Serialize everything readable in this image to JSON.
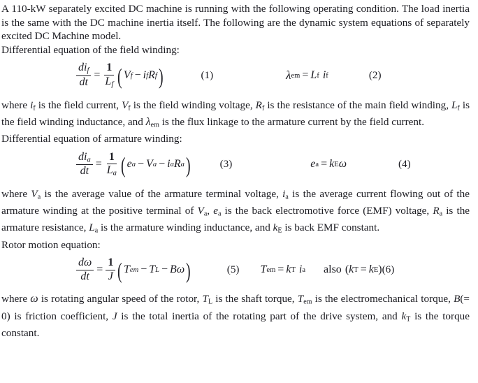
{
  "document": {
    "type": "engineering-problem-statement",
    "topic": "Separately excited DC machine dynamic model"
  },
  "intro": {
    "line1": "A 110-kW separately excited DC machine is running with the following operating condition. The",
    "line2": "load inertia is the same with the DC machine inertia itself. The following are the dynamic system",
    "line3": "equations of separately excited DC Machine model.",
    "field_heading": "Differential equation of the field winding:"
  },
  "equation1": {
    "lhs_num_d": "d",
    "lhs_num_i": "i",
    "lhs_num_sub": "f",
    "lhs_den_d": "d",
    "lhs_den_t": "t",
    "equals": "=",
    "rhs_num": "1",
    "rhs_den_L": "L",
    "rhs_den_sub": "f",
    "open_paren": "(",
    "V": "V",
    "V_sub": "f",
    "minus": "−",
    "i": "i",
    "i_sub": "f",
    "R": "R",
    "R_sub": "f",
    "close_paren": ")",
    "number": "(1)"
  },
  "equation2": {
    "lambda": "λ",
    "lambda_sub": "em",
    "equals": "=",
    "L": "L",
    "L_sub": "f",
    "i": "i",
    "i_sub": "f",
    "number": "(2)"
  },
  "para_field": {
    "line1_a": "where ",
    "i_f_i": "i",
    "i_f_sub": "f",
    "line1_b": " is the field current, ",
    "V_f_i": "V",
    "V_f_sub": "f",
    "line1_c": " is the field winding voltage, ",
    "R_f_i": "R",
    "R_f_sub": "f",
    "line1_d": " is the resistance of the main field winding, ",
    "L_f_i": "L",
    "L_f_sub": "f",
    "line1_e": " is the field winding inductance, and ",
    "lambda": "λ",
    "lambda_sub": "em",
    "line1_f": " is the flux linkage to the armature current by the field current.",
    "armature_heading": "Differential equation of armature winding:"
  },
  "equation3": {
    "lhs_num_d": "d",
    "lhs_num_i": "i",
    "lhs_num_sub": "a",
    "lhs_den_d": "d",
    "lhs_den_t": "t",
    "equals": "=",
    "rhs_num": "1",
    "rhs_den_L": "L",
    "rhs_den_sub": "a",
    "open_paren": "(",
    "e": "e",
    "e_sub": "a",
    "minus1": "−",
    "V": "V",
    "V_sub": "a",
    "minus2": "−",
    "i": "i",
    "i_sub": "a",
    "R": "R",
    "R_sub": "a",
    "close_paren": ")",
    "number": "(3)"
  },
  "equation4": {
    "e": "e",
    "e_sub": "a",
    "equals": "=",
    "k": "k",
    "k_sub": "E",
    "omega": "ω",
    "number": "(4)"
  },
  "para_armature": {
    "line_a": "where ",
    "V_a_i": "V",
    "V_a_sub": "a",
    "line_b": " is the average value of the armature terminal voltage, ",
    "i_a_i": "i",
    "i_a_sub": "a",
    "line_c": " is the average current flowing out of the armature winding at the positive terminal of ",
    "V_a2_i": "V",
    "V_a2_sub": "a",
    "line_d": ", ",
    "e_a_i": "e",
    "e_a_sub": "a",
    "line_e": " is the back electromotive force (EMF) voltage, ",
    "R_a_i": "R",
    "R_a_sub": "a",
    "line_f": " is the armature resistance, ",
    "L_a_i": "L",
    "L_a_sub": "a",
    "line_g": " is the armature winding inductance, and ",
    "k_E_i": "k",
    "k_E_sub": "E",
    "line_h": " is back EMF constant.",
    "rotor_heading": "Rotor motion equation:"
  },
  "equation5": {
    "lhs_num_d": "d",
    "lhs_num_omega": "ω",
    "lhs_den_d": "d",
    "lhs_den_t": "t",
    "equals": "=",
    "rhs_num": "1",
    "rhs_den_J": "J",
    "open_paren": "(",
    "T": "T",
    "T_sub": "em",
    "minus1": "−",
    "TL": "T",
    "TL_sub": "L",
    "minus2": "−",
    "B": "B",
    "omega": "ω",
    "close_paren": ")",
    "number": "(5)"
  },
  "equation6": {
    "T": "T",
    "T_sub": "em",
    "equals": "=",
    "k": "k",
    "k_sub": "T",
    "i": "i",
    "i_sub": "a",
    "also": "also",
    "open_paren": "(",
    "kT": "k",
    "kT_sub": "T",
    "equals2": "=",
    "kE": "k",
    "kE_sub": "E",
    "close_paren": ")",
    "number": "(6)"
  },
  "para_rotor": {
    "line_a": "where ",
    "omega": "ω",
    "line_b": " is rotating angular speed of the rotor, ",
    "T_L_i": "T",
    "T_L_sub": "L",
    "line_c": " is the shaft torque, ",
    "T_em_i": "T",
    "T_em_sub": "em",
    "line_d": " is the electromechanical torque, ",
    "B_i": "B",
    "line_e": "(= 0) is friction coefficient, ",
    "J_i": "J",
    "line_f": " is the total inertia of the rotating part of the drive system, and ",
    "k_T_i": "k",
    "k_T_sub": "T",
    "line_g": " is the torque constant."
  },
  "colors": {
    "text": "#1c1c22",
    "background": "#ffffff"
  }
}
